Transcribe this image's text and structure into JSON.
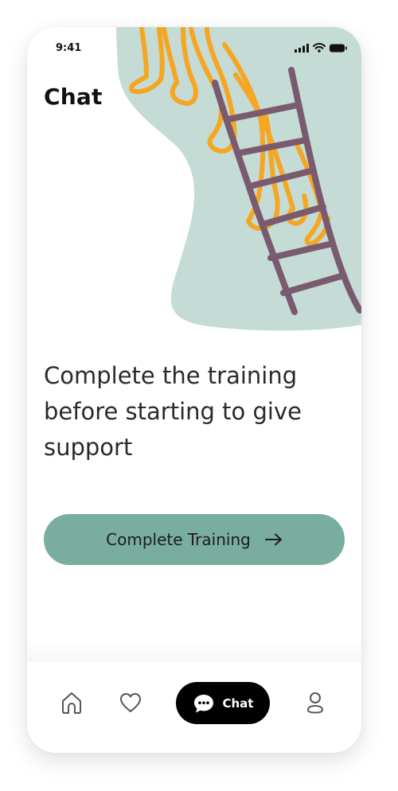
{
  "status_bar": {
    "time": "9:41"
  },
  "header": {
    "title": "Chat"
  },
  "main": {
    "message": "Complete the training before starting to give support",
    "cta_label": "Complete Training"
  },
  "tab_bar": {
    "items": [
      {
        "icon": "home-icon",
        "label": ""
      },
      {
        "icon": "heart-icon",
        "label": ""
      },
      {
        "icon": "chat-bubble-icon",
        "label": "Chat",
        "active": true
      },
      {
        "icon": "profile-icon",
        "label": ""
      }
    ]
  },
  "colors": {
    "accent_green": "#79ad9f",
    "blob": "#c5dbd5",
    "ladder": "#7a5a6e",
    "legs": "#f5a623",
    "tab_active_bg": "#000000"
  }
}
